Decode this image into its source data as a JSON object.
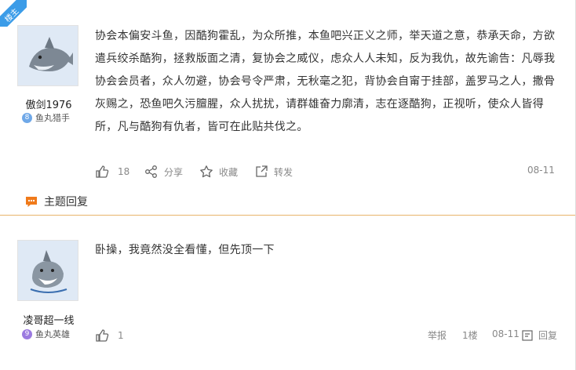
{
  "badge": "楼主",
  "posts": [
    {
      "user": {
        "name": "傲剑1976",
        "level_num": "8",
        "level_title": "鱼丸猎手",
        "level_color": "#6fa8e8"
      },
      "content": "协会本偏安斗鱼，因酷狗霍乱，为众所推，本鱼吧兴正义之师，举天道之意，恭承天命，方欲遣兵绞杀酷狗，拯救版面之清，复协会之威仪，虑众人人未知，反为我仇，故先谕告：凡辱我协会会员者，众人勿避，协会号令严肃，无秋毫之犯，背协会自甯于挂部，盖罗马之人，撒骨灰赐之，恐鱼吧久污膻腥，众人扰扰，请群雄奋力廓清，志在逐酷狗，正视听，使众人皆得所，凡与酷狗有仇者，皆可在此贴共伐之。",
      "likes": "18",
      "share": "分享",
      "collect": "收藏",
      "forward": "转发",
      "date": "08-11"
    },
    {
      "user": {
        "name": "凌哥超一线",
        "level_num": "9",
        "level_title": "鱼丸英雄",
        "level_color": "#9b7ae0"
      },
      "content": "卧操，我竟然没全看懂，但先顶一下",
      "likes": "1",
      "report": "举报",
      "floor": "1楼",
      "date": "08-11",
      "reply": "回复"
    }
  ],
  "reply_section": {
    "label": "主题回复",
    "icon": "comment-icon",
    "accent": "#f07a1a"
  },
  "colors": {
    "divider": "#e8b46b",
    "badge": "#3b9ce8"
  }
}
